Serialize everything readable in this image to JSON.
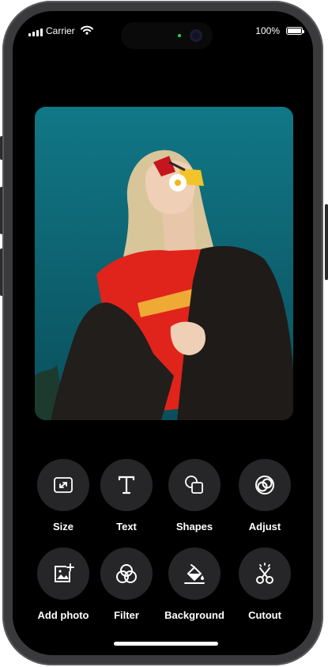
{
  "status_bar": {
    "carrier": "Carrier",
    "battery_percent": "100%",
    "battery_level": 1.0,
    "icons": [
      "signal-icon",
      "wifi-icon",
      "battery-icon"
    ]
  },
  "photo": {
    "description_icon": "photo-preview",
    "colors": {
      "background": "#0f6e7c",
      "shirt": "#e0241b",
      "jacket": "#1d1a18"
    }
  },
  "tools": [
    {
      "label": "Size",
      "icon": "resize-icon"
    },
    {
      "label": "Text",
      "icon": "text-icon"
    },
    {
      "label": "Shapes",
      "icon": "shapes-icon"
    },
    {
      "label": "Adjust",
      "icon": "adjust-icon"
    },
    {
      "label": "Add photo",
      "icon": "add-photo-icon"
    },
    {
      "label": "Filter",
      "icon": "filter-icon"
    },
    {
      "label": "Background",
      "icon": "background-fill-icon"
    },
    {
      "label": "Cutout",
      "icon": "cutout-scissors-icon"
    }
  ],
  "theme": {
    "screen_bg": "#000000",
    "tool_bg": "#262628",
    "text": "#ffffff"
  }
}
